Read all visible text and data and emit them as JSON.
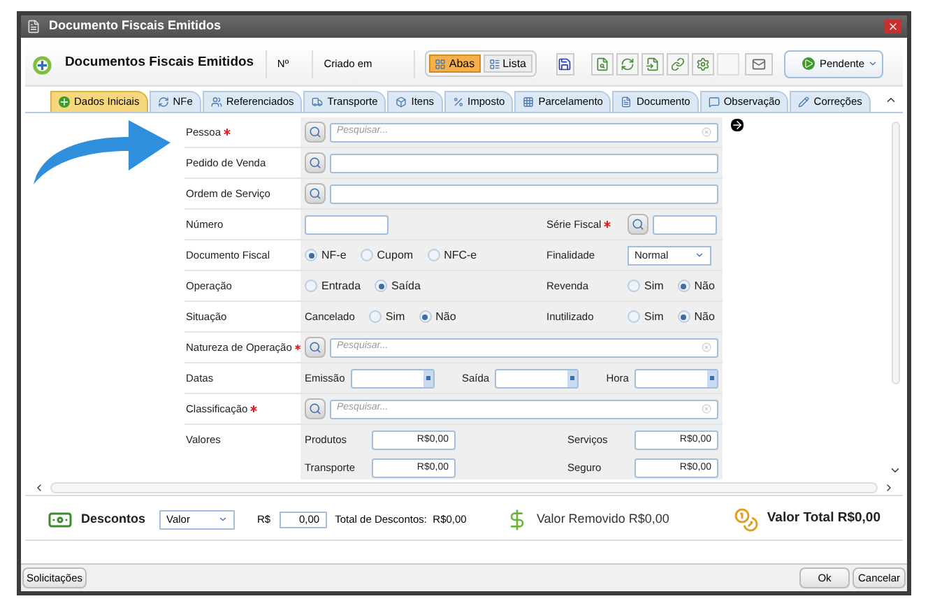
{
  "window": {
    "title": "Documento Fiscais Emitidos"
  },
  "header": {
    "title": "Documentos Fiscais Emitidos",
    "number_label": "Nº",
    "created_label": "Criado em",
    "views": [
      {
        "label": "Abas",
        "selected": true
      },
      {
        "label": "Lista",
        "selected": false
      }
    ],
    "status": "Pendente"
  },
  "tabs": [
    {
      "label": "Dados Iniciais",
      "selected": true
    },
    {
      "label": "NFe",
      "selected": false
    },
    {
      "label": "Referenciados",
      "selected": false
    },
    {
      "label": "Transporte",
      "selected": false
    },
    {
      "label": "Itens",
      "selected": false
    },
    {
      "label": "Imposto",
      "selected": false
    },
    {
      "label": "Parcelamento",
      "selected": false
    },
    {
      "label": "Documento",
      "selected": false
    },
    {
      "label": "Observação",
      "selected": false
    },
    {
      "label": "Correções",
      "selected": false
    }
  ],
  "form": {
    "rows": [
      {
        "kind": "lookup",
        "label": "Pessoa",
        "required": true,
        "placeholder": "Pesquisar..."
      },
      {
        "kind": "lookup",
        "label": "Pedido de Venda",
        "required": false
      },
      {
        "kind": "lookup",
        "label": "Ordem de Serviço",
        "required": false
      },
      {
        "kind": "number",
        "label": "Número",
        "right": {
          "kind": "lookup",
          "label": "Série Fiscal",
          "required": true
        }
      },
      {
        "kind": "radio",
        "label": "Documento Fiscal",
        "options": [
          {
            "label": "NF-e",
            "selected": true
          },
          {
            "label": "Cupom",
            "selected": false
          },
          {
            "label": "NFC-e",
            "selected": false
          }
        ],
        "right": {
          "kind": "select",
          "label": "Finalidade",
          "value": "Normal"
        }
      },
      {
        "kind": "radio",
        "label": "Operação",
        "options": [
          {
            "label": "Entrada",
            "selected": false
          },
          {
            "label": "Saída",
            "selected": true
          }
        ],
        "right": {
          "kind": "radio",
          "label": "Revenda",
          "options": [
            {
              "label": "Sim",
              "selected": false
            },
            {
              "label": "Não",
              "selected": true
            }
          ]
        }
      },
      {
        "kind": "radio",
        "label": "Situação",
        "prefix": "Cancelado",
        "options": [
          {
            "label": "Sim",
            "selected": false
          },
          {
            "label": "Não",
            "selected": true
          }
        ],
        "right": {
          "kind": "radio",
          "label": "Inutilizado",
          "options": [
            {
              "label": "Sim",
              "selected": false
            },
            {
              "label": "Não",
              "selected": true
            }
          ]
        }
      },
      {
        "kind": "lookup",
        "label": "Natureza de Operação",
        "required": true,
        "placeholder": "Pesquisar..."
      },
      {
        "kind": "dates",
        "label": "Datas",
        "fields": [
          "Emissão",
          "Saída",
          "Hora"
        ]
      },
      {
        "kind": "lookup",
        "label": "Classificação",
        "required": true,
        "placeholder": "Pesquisar..."
      },
      {
        "kind": "values",
        "label": "Valores",
        "fields": [
          {
            "label": "Produtos",
            "value": "R$0,00"
          },
          {
            "label": "Serviços",
            "value": "R$0,00"
          },
          {
            "label": "Transporte",
            "value": "R$0,00"
          },
          {
            "label": "Seguro",
            "value": "R$0,00"
          }
        ]
      }
    ]
  },
  "footer": {
    "discounts_label": "Descontos",
    "discount_type": "Valor",
    "currency": "R$",
    "discount_value": "0,00",
    "total_discounts": "Total de Descontos:  R$0,00",
    "removed": "Valor Removido R$0,00",
    "total": "Valor Total R$0,00"
  },
  "buttons": {
    "requests": "Solicitações",
    "ok": "Ok",
    "cancel": "Cancelar"
  }
}
